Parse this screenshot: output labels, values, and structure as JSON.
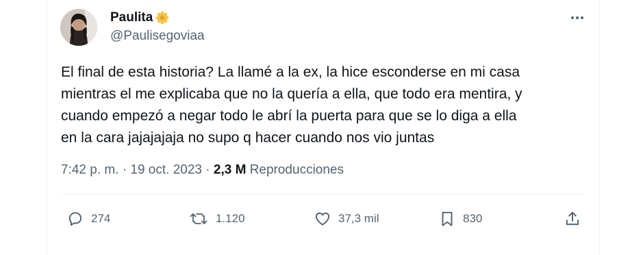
{
  "user": {
    "name": "Paulita",
    "handle": "@Paulisegoviaa"
  },
  "tweet": {
    "lines": [
      "El final de esta historia? La llamé a la ex, la hice esconderse en mi casa",
      "mientras el me explicaba que no la quería a ella, que todo era mentira, y",
      "cuando empezó a negar todo le abrí la puerta para que se lo diga a ella",
      "en la cara jajajajaja no supo q hacer cuando nos vio juntas"
    ]
  },
  "meta": {
    "time": "7:42 p. m.",
    "separator": "·",
    "date": "19 oct. 2023",
    "views_count": "2,3 M",
    "views_label": "Reproducciones"
  },
  "actions": {
    "replies": "274",
    "retweets": "1.120",
    "likes": "37,3 mil",
    "bookmarks": "830"
  },
  "icons": {
    "name_badge": "flower-icon",
    "more": "more-icon",
    "reply": "reply-icon",
    "retweet": "retweet-icon",
    "like": "heart-icon",
    "bookmark": "bookmark-icon",
    "share": "share-icon"
  },
  "colors": {
    "text": "#0f1419",
    "secondary": "#536471",
    "border": "#eff3f4",
    "badge": "#f5c542"
  }
}
